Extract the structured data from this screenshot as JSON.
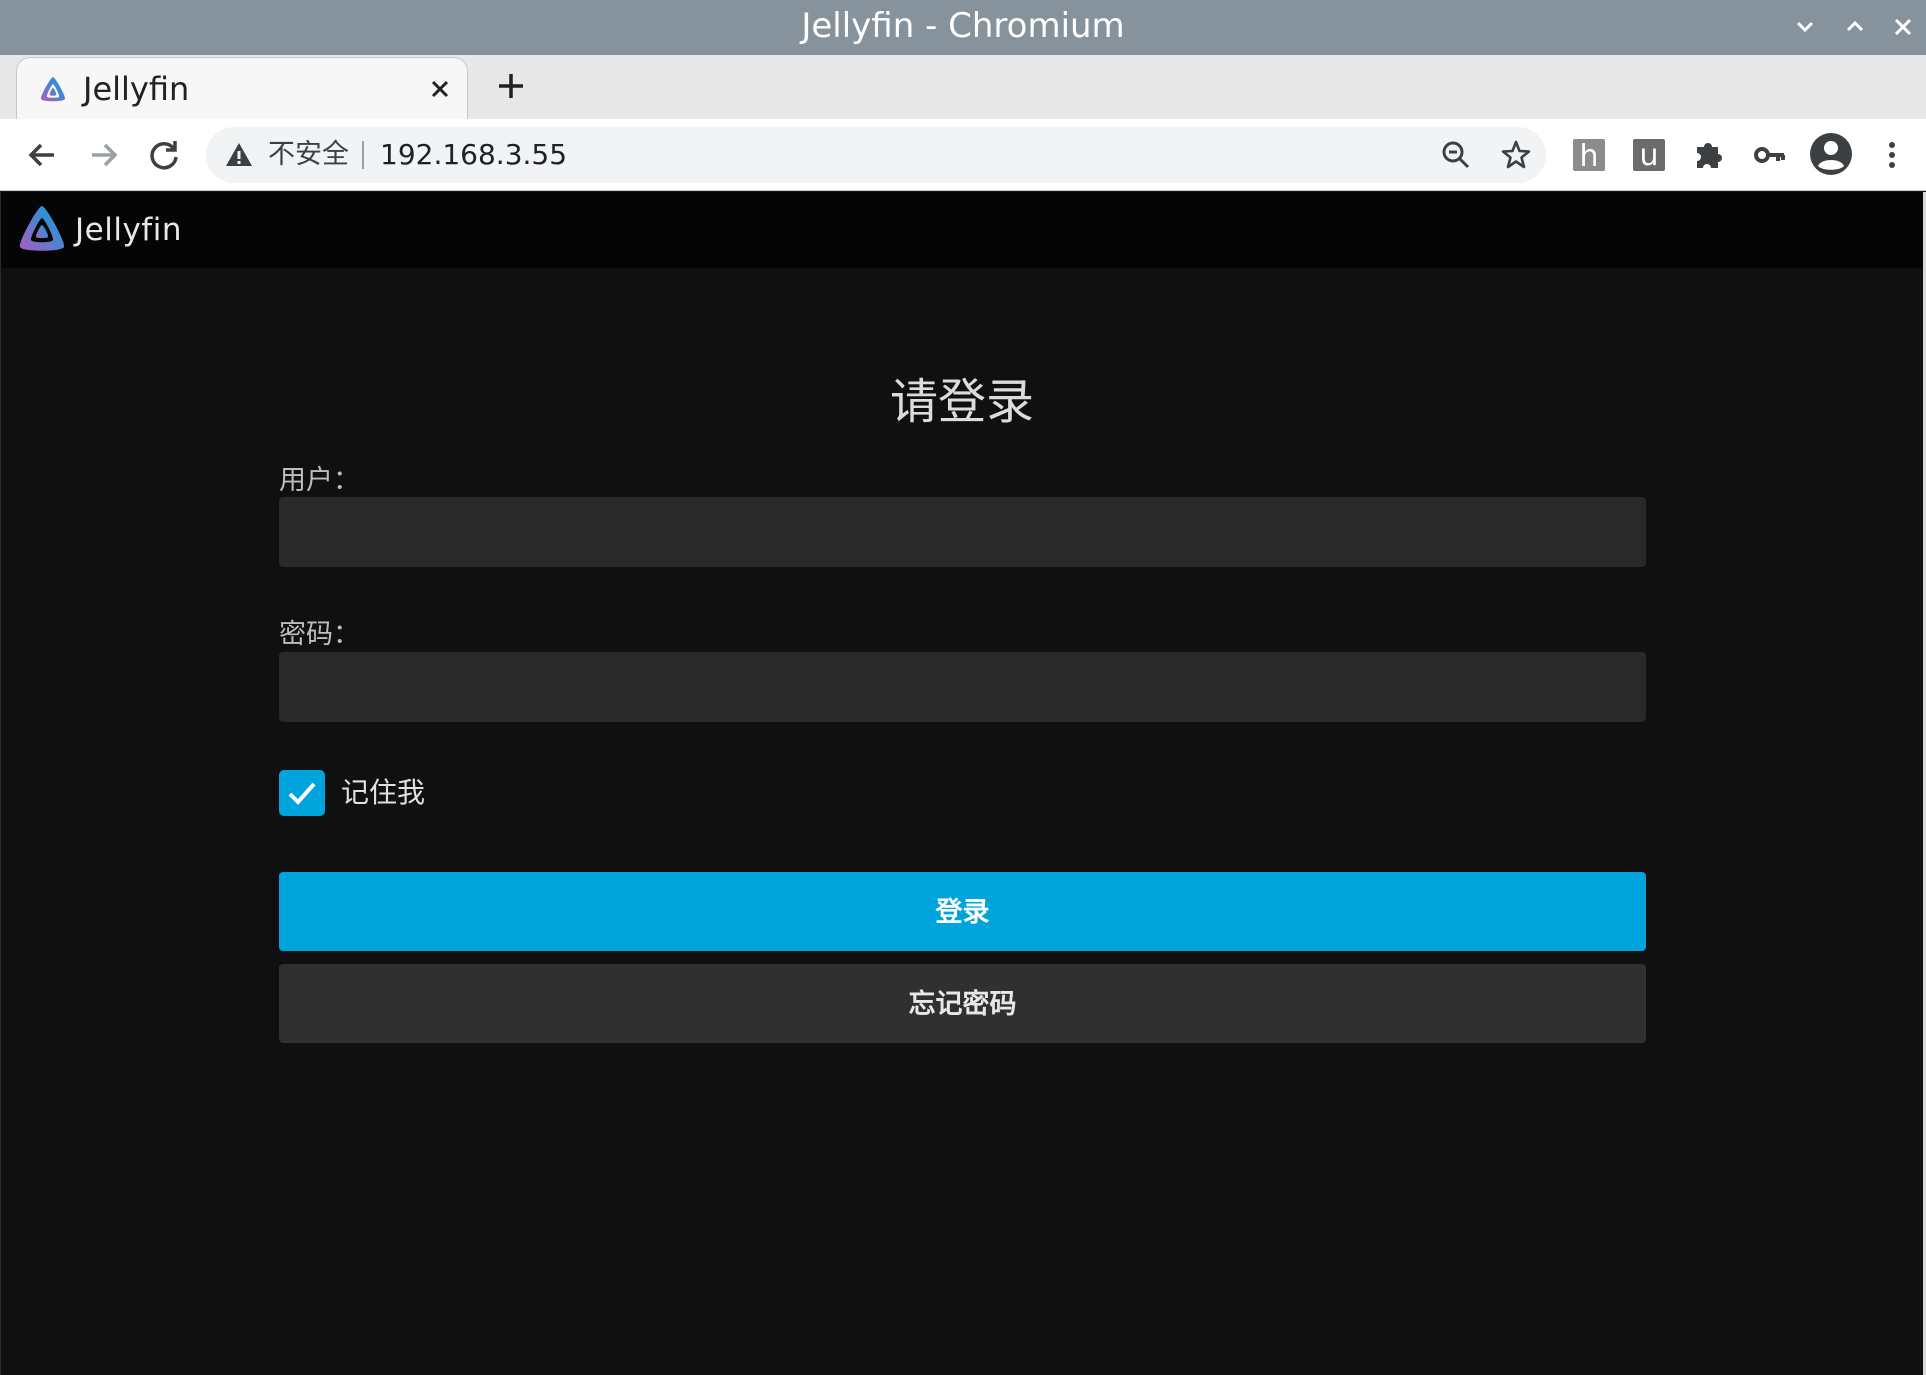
{
  "window": {
    "title": "Jellyfin - Chromium"
  },
  "browser": {
    "tab": {
      "title": "Jellyfin"
    },
    "omnibox": {
      "security_label": "不安全",
      "url": "192.168.3.55"
    }
  },
  "app": {
    "brand": "Jellyfin",
    "accent_color": "#00a4dc"
  },
  "login": {
    "title": "请登录",
    "username_label": "用户：",
    "username_value": "",
    "password_label": "密码：",
    "password_value": "",
    "remember_me_label": "记住我",
    "remember_me_checked": true,
    "login_button": "登录",
    "forgot_password_button": "忘记密码"
  }
}
